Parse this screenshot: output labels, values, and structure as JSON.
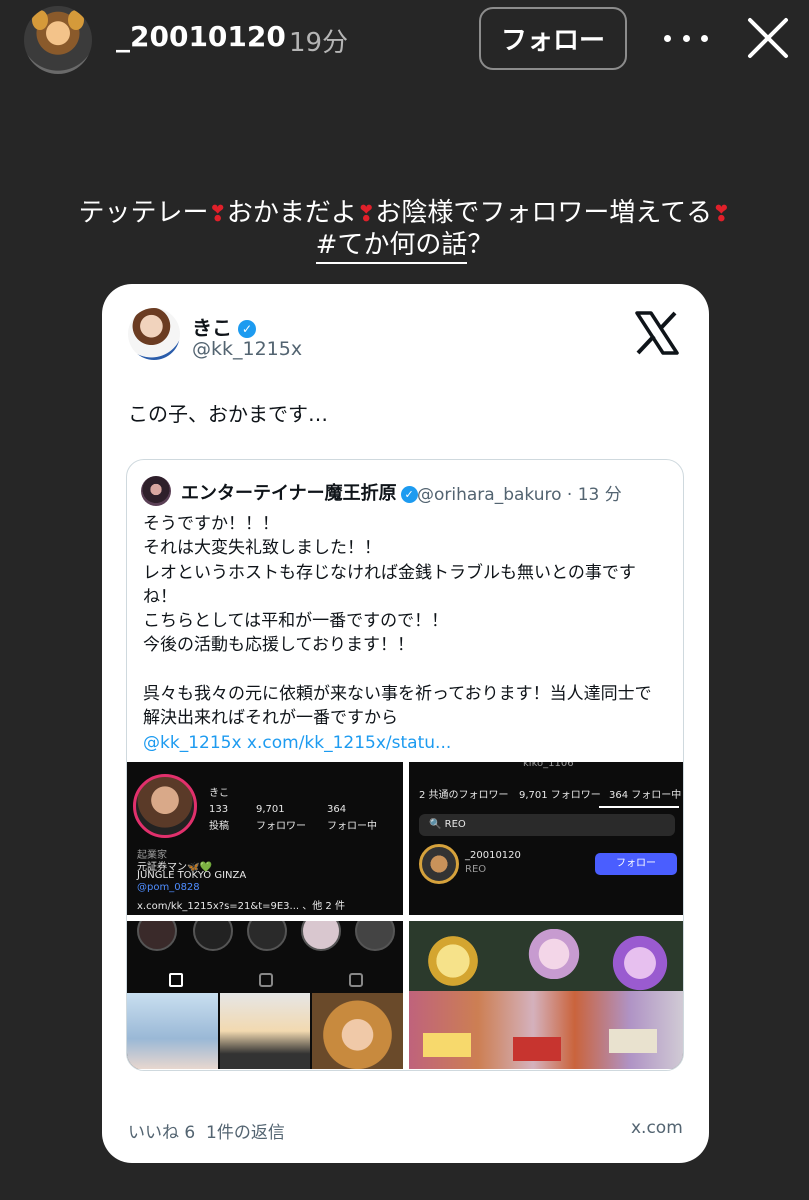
{
  "story": {
    "username": "_20010120",
    "time": "19分",
    "follow_label": "フォロー"
  },
  "caption": {
    "part1": "テッテレー",
    "part2": "おかまだよ",
    "part3": "お陰様でフォロワー増えてる",
    "hashtag": "#てか何の話",
    "tail": "？",
    "heart": "❣"
  },
  "tweet": {
    "name": "きこ",
    "handle": "@kk_1215x",
    "text": "この子、おかまです…",
    "likes": "いいね 6",
    "replies": "1件の返信",
    "source": "x.com",
    "quote": {
      "name": "エンターテイナー魔王折原",
      "meta": "@orihara_bakuro · 13 分",
      "lines": [
        "そうですか！！！",
        "それは大変失礼致しました！！",
        "レオというホストも存じなければ金銭トラブルも無いとの事です",
        "ね！",
        "こちらとしては平和が一番ですので！！",
        "今後の活動も応援しております！！",
        "",
        "呉々も我々の元に依頼が来ない事を祈っております！当人達同士で",
        "解決出来ればそれが一番ですから"
      ],
      "link": "@kk_1215x x.com/kk_1215x/statu..."
    },
    "screenshot1": {
      "name": "きこ",
      "posts": "133",
      "posts_label": "投稿",
      "followers": "9,701",
      "followers_label": "フォロワー",
      "following": "364",
      "following_label": "フォロー中",
      "bio1": "起業家",
      "bio2": "元証券マン🦋💚",
      "bio3": "JUNGLE TOKYO GINZA",
      "bio4": "@pom_0828",
      "bio5": "x.com/kk_1215x?s=21&t=9E3... 、他 2 件"
    },
    "screenshot2": {
      "header": "kiko_1106",
      "tab1": "2 共通のフォロワー",
      "tab2": "9,701 フォロワー",
      "tab3": "364 フォロー中",
      "search": "REO",
      "user": "_20010120",
      "user_sub": "REO",
      "button": "フォロー"
    }
  }
}
